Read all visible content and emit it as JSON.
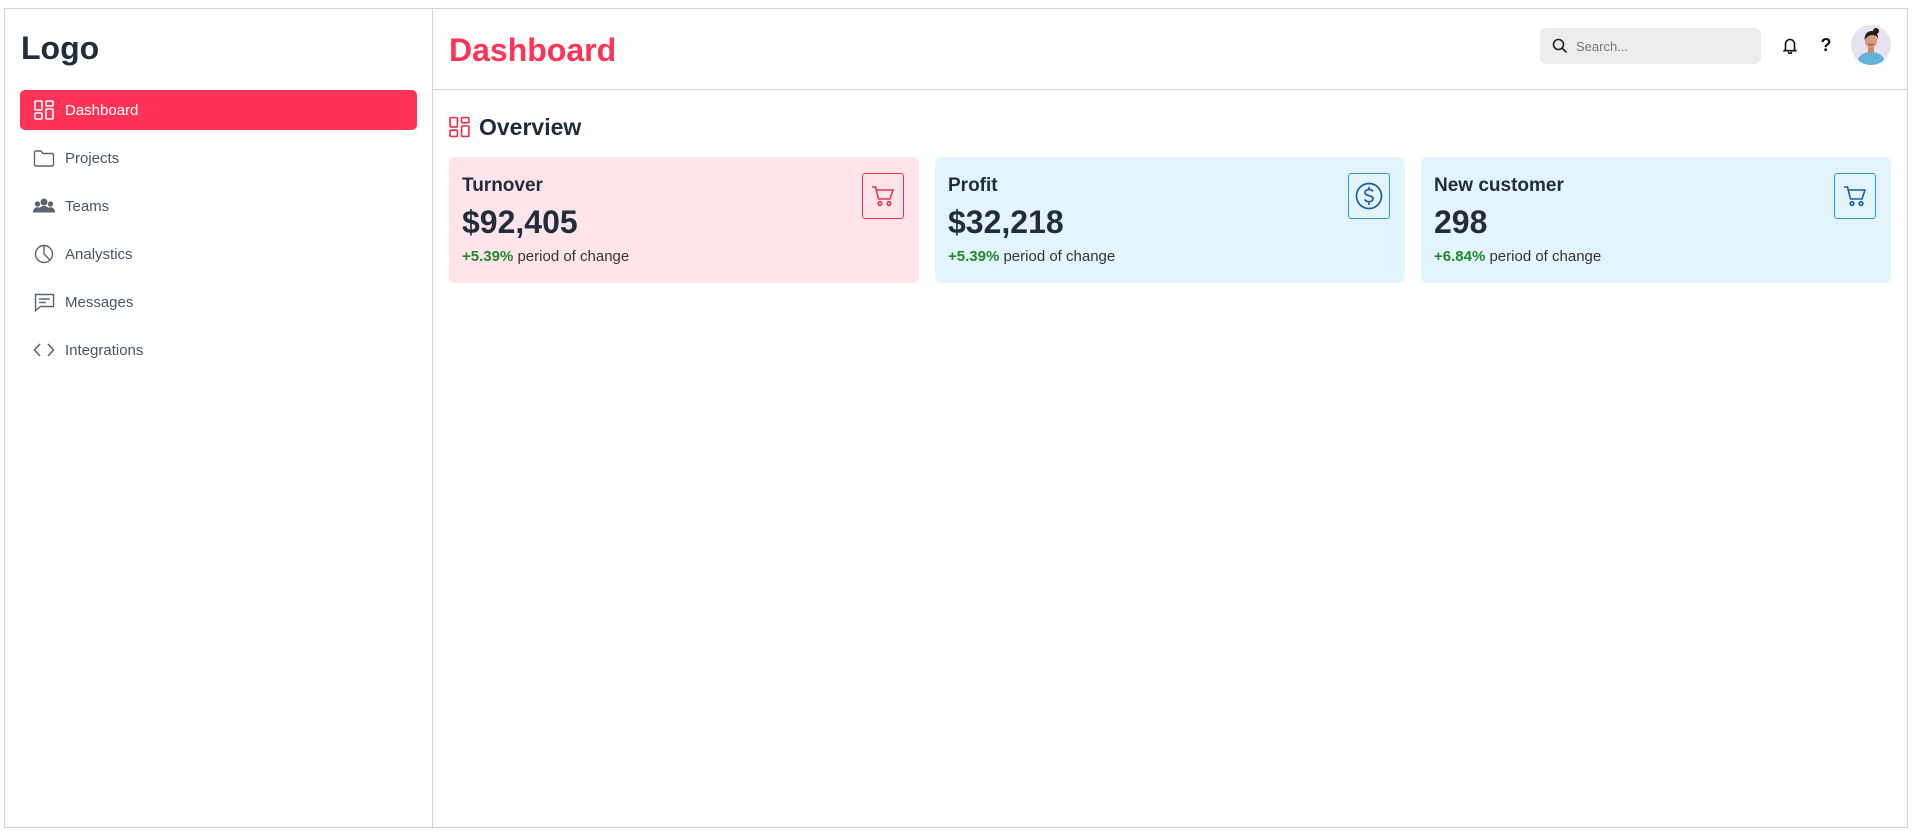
{
  "sidebar": {
    "logo": "Logo",
    "items": [
      {
        "label": "Dashboard",
        "icon": "dashboard-icon",
        "active": true
      },
      {
        "label": "Projects",
        "icon": "folder-icon"
      },
      {
        "label": "Teams",
        "icon": "users-icon"
      },
      {
        "label": "Analystics",
        "icon": "pie-chart-icon"
      },
      {
        "label": "Messages",
        "icon": "message-icon"
      },
      {
        "label": "Integrations",
        "icon": "code-icon"
      }
    ]
  },
  "header": {
    "title": "Dashboard",
    "search_placeholder": "Search...",
    "help_label": "?"
  },
  "overview": {
    "title": "Overview",
    "cards": [
      {
        "label": "Turnover",
        "value": "$92,405",
        "change": "+5.39%",
        "change_text": " period of change",
        "icon": "cart-icon"
      },
      {
        "label": "Profit",
        "value": "$32,218",
        "change": "+5.39%",
        "change_text": " period of change",
        "icon": "dollar-circle-icon"
      },
      {
        "label": "New customer",
        "value": "298",
        "change": "+6.84%",
        "change_text": " period of change",
        "icon": "cart-icon"
      }
    ]
  },
  "colors": {
    "accent": "#ff3355",
    "pink_card": "#ffe5e9",
    "blue_card": "#e3f4fc",
    "positive": "#1c8a2a"
  }
}
